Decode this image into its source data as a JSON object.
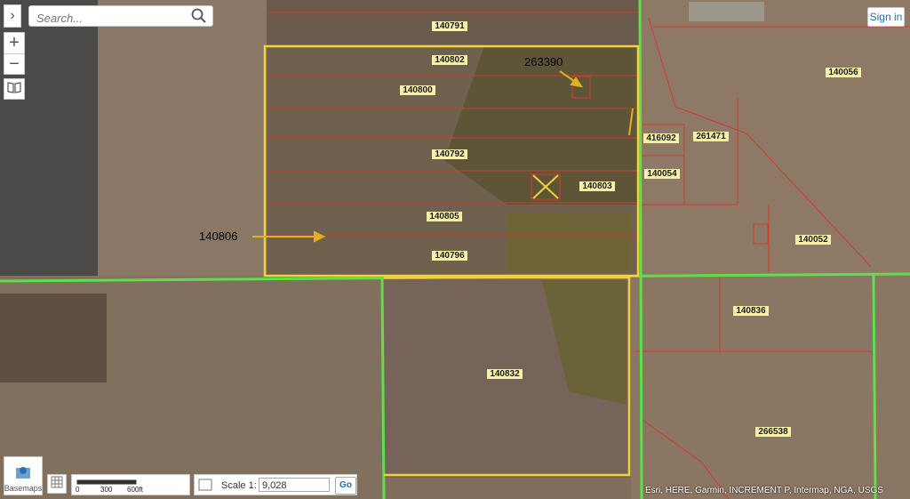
{
  "map": {
    "parcel_labels": [
      "140791",
      "140802",
      "140800",
      "140792",
      "140805",
      "140796",
      "140803",
      "140056",
      "416092",
      "261471",
      "140054",
      "140052",
      "140836",
      "140832",
      "266538"
    ],
    "annotations": [
      "263390",
      "140806"
    ],
    "colors": {
      "selected_parcel": "#f2d23a",
      "road": "#5ee04a",
      "parcel_line": "#d23a2a",
      "arrow": "#e0b020",
      "label_bg": "#f6f0a8"
    }
  },
  "search": {
    "placeholder": "Search...",
    "icon": "search-icon"
  },
  "controls": {
    "zoom_in": "+",
    "zoom_out": "−",
    "bookmark_icon": "book-icon",
    "expand_icon": "chevron-right-icon"
  },
  "header": {
    "signin_label": "Sign in"
  },
  "footer": {
    "basemaps_label": "Basemaps",
    "scalebar_ticks": [
      "0",
      "300",
      "600ft"
    ],
    "scale_label": "Scale 1:",
    "scale_value": "9,028",
    "go_label": "Go",
    "attribution": "Esri, HERE, Garmin, INCREMENT P, Intermap, NGA, USGS"
  }
}
